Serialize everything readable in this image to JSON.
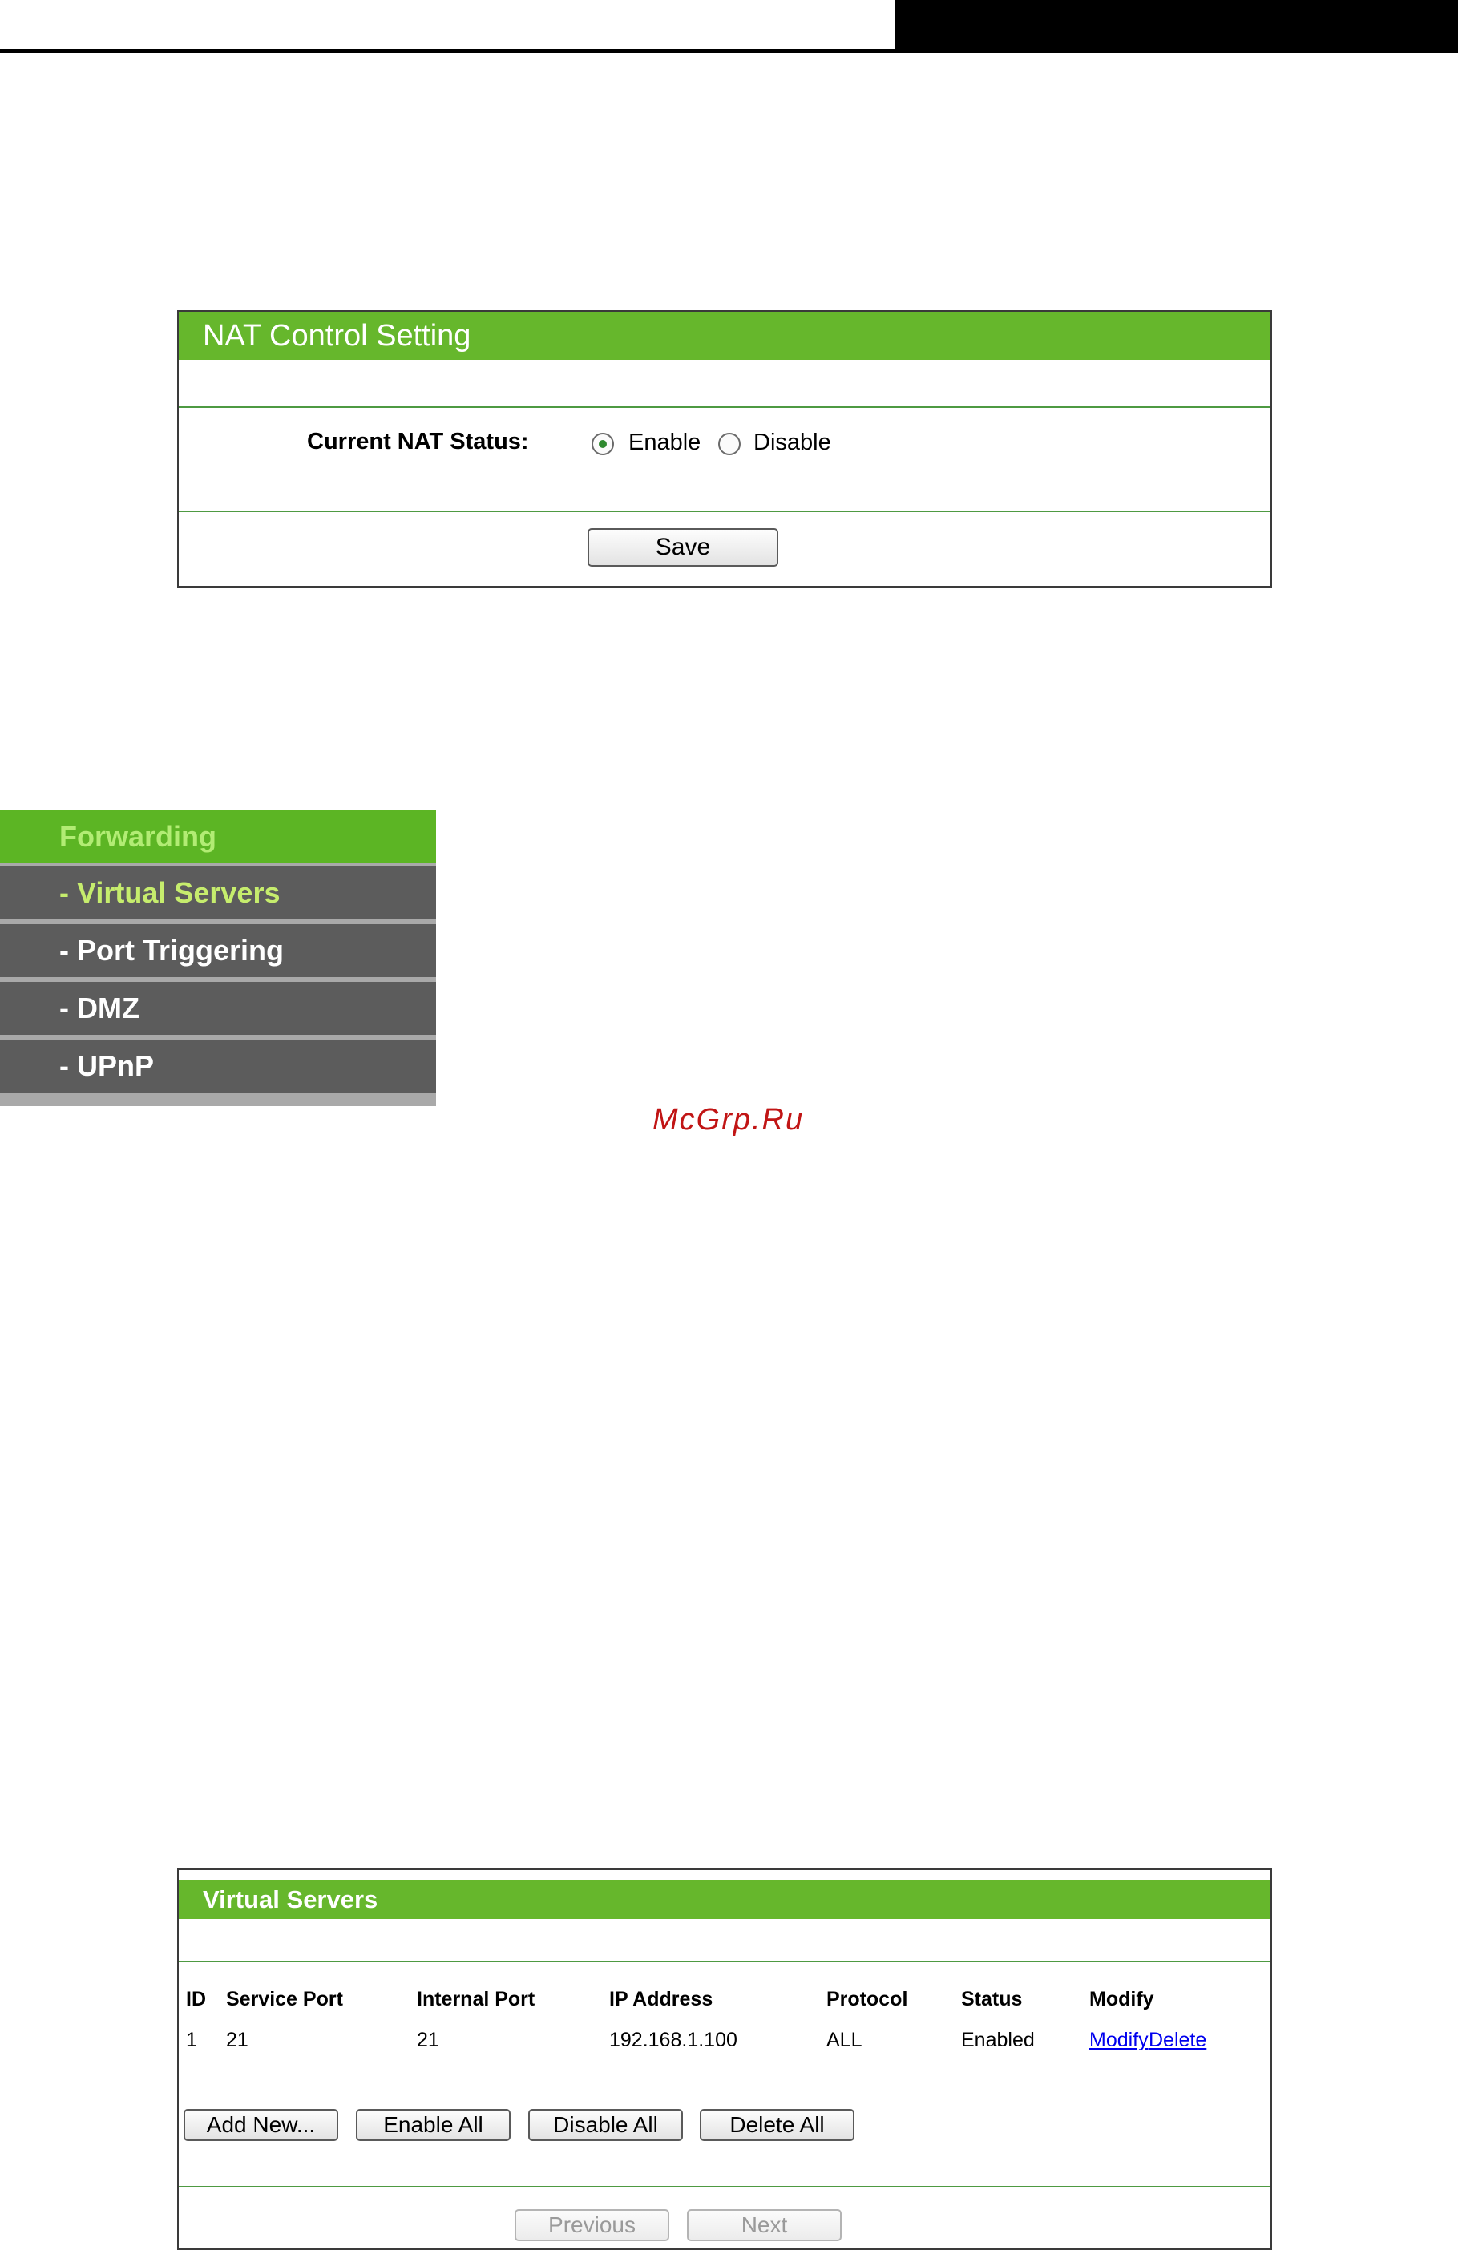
{
  "nat_panel": {
    "title": "NAT Control Setting",
    "status_label": "Current NAT Status:",
    "options": [
      "Enable",
      "Disable"
    ],
    "selected": "Enable",
    "save_label": "Save"
  },
  "menu": {
    "header": "Forwarding",
    "items": [
      "- Virtual Servers",
      "- Port Triggering",
      "- DMZ",
      "- UPnP"
    ],
    "active": "- Virtual Servers"
  },
  "watermark": "McGrp.Ru",
  "virtual_servers": {
    "title": "Virtual Servers",
    "columns": [
      "ID",
      "Service Port",
      "Internal Port",
      "IP Address",
      "Protocol",
      "Status",
      "Modify"
    ],
    "rows": [
      {
        "id": "1",
        "service_port": "21",
        "internal_port": "21",
        "ip": "192.168.1.100",
        "protocol": "ALL",
        "status": "Enabled",
        "modify": "Modify",
        "delete": "Delete"
      }
    ],
    "buttons": {
      "add_new": "Add New...",
      "enable_all": "Enable All",
      "disable_all": "Disable All",
      "delete_all": "Delete All"
    },
    "pager": {
      "previous": "Previous",
      "next": "Next"
    }
  },
  "colors": {
    "accent_green": "#66b72c",
    "menu_grey": "#5c5c5c",
    "link_blue": "#0000ee"
  }
}
